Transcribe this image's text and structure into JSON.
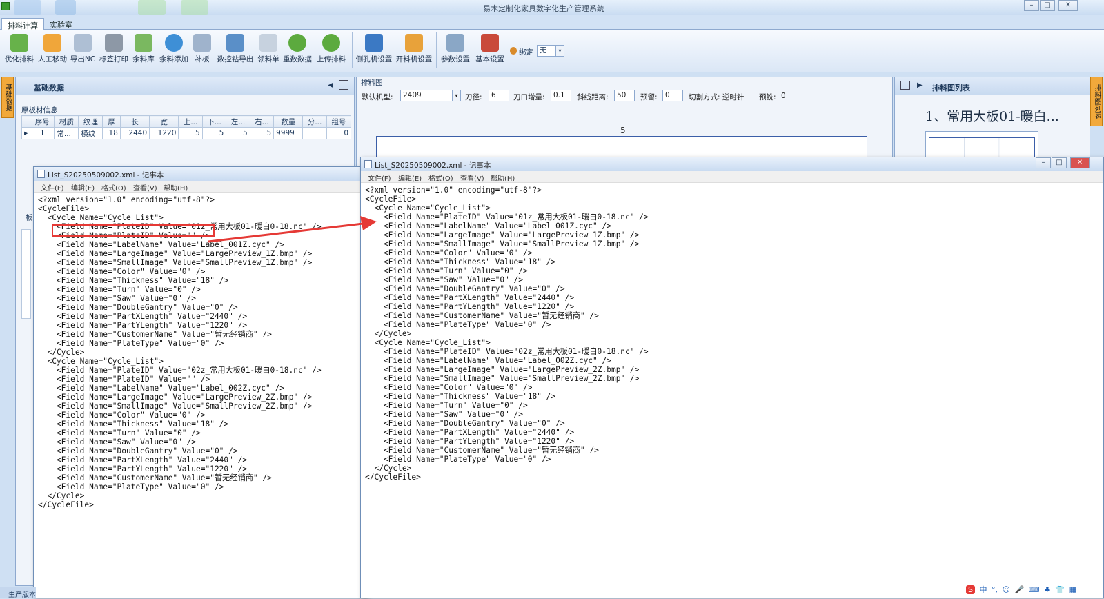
{
  "app": {
    "title": "易木定制化家具数字化生产管理系统",
    "tabs": [
      "排料计算",
      "实验室"
    ],
    "window_controls": [
      "–",
      "□",
      "✕"
    ]
  },
  "ribbon": {
    "buttons": [
      "优化排料",
      "人工移动",
      "导出NC",
      "标签打印",
      "余料库",
      "余料添加",
      "补板",
      "数控钻导出",
      "领料单",
      "重数数据",
      "上传排料",
      "侧孔机设置",
      "开料机设置",
      "参数设置",
      "基本设置"
    ],
    "bind_label": "绑定",
    "bind_value": "无"
  },
  "left_panel": {
    "title": "基础数据",
    "side_tab": "基础数据",
    "group_title": "原板材信息",
    "columns": [
      "序号",
      "材质",
      "纹理",
      "厚",
      "长",
      "宽",
      "上...",
      "下...",
      "左...",
      "右...",
      "数量",
      "分...",
      "组号"
    ],
    "row": [
      "1",
      "常...",
      "横纹",
      "18",
      "2440",
      "1220",
      "5",
      "5",
      "5",
      "5",
      "9999",
      "",
      "0"
    ],
    "lower_label": "板"
  },
  "center_panel": {
    "title": "排料图",
    "params": {
      "machine_label": "默认机型:",
      "machine_value": "2409",
      "tool_label": "刀径:",
      "tool_value": "6",
      "increment_label": "刀口增量:",
      "increment_value": "0.1",
      "diag_label": "斜线距离:",
      "diag_value": "50",
      "reserve_label": "预留:",
      "reserve_value": "0",
      "cut_label": "切割方式: 逆时针",
      "drill_label": "预铣:",
      "drill_value": "0"
    },
    "canvas_label": "5"
  },
  "right_panel": {
    "title": "排料图列表",
    "side_tab": "排料图列表",
    "first_item": "1、常用大板01-暖白..."
  },
  "notepad_left": {
    "title": "List_S20250509002.xml - 记事本",
    "menu": [
      "文件(F)",
      "编辑(E)",
      "格式(O)",
      "查看(V)",
      "帮助(H)"
    ],
    "content": "<?xml version=\"1.0\" encoding=\"utf-8\"?>\n<CycleFile>\n  <Cycle Name=\"Cycle_List\">\n    <Field Name=\"PlateID\" Value=\"01z_常用大板01-暖白0-18.nc\" />\n    <Field Name=\"PlateID\" Value=\"\" />\n    <Field Name=\"LabelName\" Value=\"Label_001Z.cyc\" />\n    <Field Name=\"LargeImage\" Value=\"LargePreview_1Z.bmp\" />\n    <Field Name=\"SmallImage\" Value=\"SmallPreview_1Z.bmp\" />\n    <Field Name=\"Color\" Value=\"0\" />\n    <Field Name=\"Thickness\" Value=\"18\" />\n    <Field Name=\"Turn\" Value=\"0\" />\n    <Field Name=\"Saw\" Value=\"0\" />\n    <Field Name=\"DoubleGantry\" Value=\"0\" />\n    <Field Name=\"PartXLength\" Value=\"2440\" />\n    <Field Name=\"PartYLength\" Value=\"1220\" />\n    <Field Name=\"CustomerName\" Value=\"暂无经销商\" />\n    <Field Name=\"PlateType\" Value=\"0\" />\n  </Cycle>\n  <Cycle Name=\"Cycle_List\">\n    <Field Name=\"PlateID\" Value=\"02z_常用大板01-暖白0-18.nc\" />\n    <Field Name=\"PlateID\" Value=\"\" />\n    <Field Name=\"LabelName\" Value=\"Label_002Z.cyc\" />\n    <Field Name=\"LargeImage\" Value=\"LargePreview_2Z.bmp\" />\n    <Field Name=\"SmallImage\" Value=\"SmallPreview_2Z.bmp\" />\n    <Field Name=\"Color\" Value=\"0\" />\n    <Field Name=\"Thickness\" Value=\"18\" />\n    <Field Name=\"Turn\" Value=\"0\" />\n    <Field Name=\"Saw\" Value=\"0\" />\n    <Field Name=\"DoubleGantry\" Value=\"0\" />\n    <Field Name=\"PartXLength\" Value=\"2440\" />\n    <Field Name=\"PartYLength\" Value=\"1220\" />\n    <Field Name=\"CustomerName\" Value=\"暂无经销商\" />\n    <Field Name=\"PlateType\" Value=\"0\" />\n  </Cycle>\n</CycleFile>"
  },
  "notepad_right": {
    "title": "List_S20250509002.xml - 记事本",
    "menu": [
      "文件(F)",
      "编辑(E)",
      "格式(O)",
      "查看(V)",
      "帮助(H)"
    ],
    "content": "<?xml version=\"1.0\" encoding=\"utf-8\"?>\n<CycleFile>\n  <Cycle Name=\"Cycle_List\">\n    <Field Name=\"PlateID\" Value=\"01z_常用大板01-暖白0-18.nc\" />\n    <Field Name=\"LabelName\" Value=\"Label_001Z.cyc\" />\n    <Field Name=\"LargeImage\" Value=\"LargePreview_1Z.bmp\" />\n    <Field Name=\"SmallImage\" Value=\"SmallPreview_1Z.bmp\" />\n    <Field Name=\"Color\" Value=\"0\" />\n    <Field Name=\"Thickness\" Value=\"18\" />\n    <Field Name=\"Turn\" Value=\"0\" />\n    <Field Name=\"Saw\" Value=\"0\" />\n    <Field Name=\"DoubleGantry\" Value=\"0\" />\n    <Field Name=\"PartXLength\" Value=\"2440\" />\n    <Field Name=\"PartYLength\" Value=\"1220\" />\n    <Field Name=\"CustomerName\" Value=\"暂无经销商\" />\n    <Field Name=\"PlateType\" Value=\"0\" />\n  </Cycle>\n  <Cycle Name=\"Cycle_List\">\n    <Field Name=\"PlateID\" Value=\"02z_常用大板01-暖白0-18.nc\" />\n    <Field Name=\"LabelName\" Value=\"Label_002Z.cyc\" />\n    <Field Name=\"LargeImage\" Value=\"LargePreview_2Z.bmp\" />\n    <Field Name=\"SmallImage\" Value=\"SmallPreview_2Z.bmp\" />\n    <Field Name=\"Color\" Value=\"0\" />\n    <Field Name=\"Thickness\" Value=\"18\" />\n    <Field Name=\"Turn\" Value=\"0\" />\n    <Field Name=\"Saw\" Value=\"0\" />\n    <Field Name=\"DoubleGantry\" Value=\"0\" />\n    <Field Name=\"PartXLength\" Value=\"2440\" />\n    <Field Name=\"PartYLength\" Value=\"1220\" />\n    <Field Name=\"CustomerName\" Value=\"暂无经销商\" />\n    <Field Name=\"PlateType\" Value=\"0\" />\n  </Cycle>\n</CycleFile>"
  },
  "status": {
    "bottom_label": "生产版本",
    "tray_items": [
      "S",
      "中",
      "°,",
      "☺",
      "🎤",
      "⌨",
      "♣",
      "👕",
      "▦"
    ]
  },
  "colors": {
    "accent_orange": "#f2a93b",
    "highlight_red": "#e53935"
  }
}
